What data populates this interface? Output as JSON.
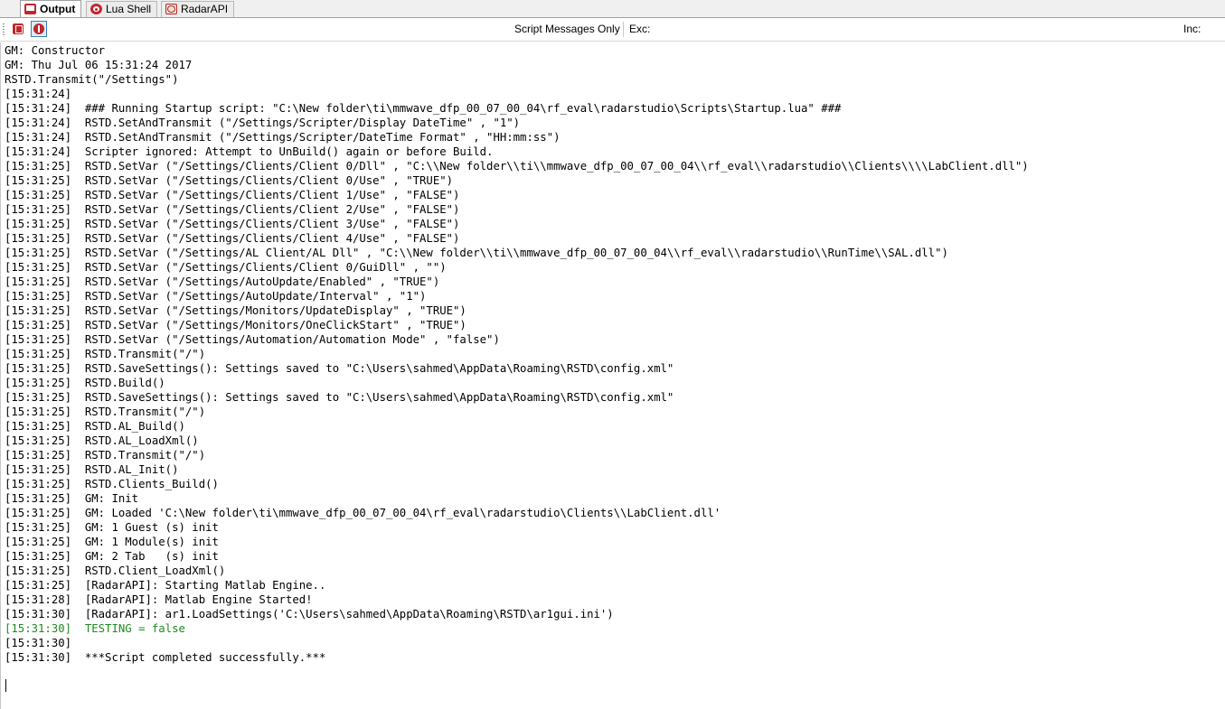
{
  "tabs": [
    {
      "label": "Output",
      "icon": "output-icon",
      "active": true
    },
    {
      "label": "Lua Shell",
      "icon": "lua-icon",
      "active": false
    },
    {
      "label": "RadarAPI",
      "icon": "radar-icon",
      "active": false
    }
  ],
  "toolbar": {
    "clear_icon": "clear-output-icon",
    "info_icon": "info-filter-icon",
    "filter_label": "Script Messages Only",
    "exc_label": "Exc:",
    "inc_label": "Inc:"
  },
  "colors": {
    "icon_red": "#c0282d",
    "success_green": "#1f8a1f"
  },
  "log_lines": [
    "GM: Constructor",
    "GM: Thu Jul 06 15:31:24 2017",
    "RSTD.Transmit(\"/Settings\")",
    "[15:31:24]",
    "[15:31:24]  ### Running Startup script: \"C:\\New folder\\ti\\mmwave_dfp_00_07_00_04\\rf_eval\\radarstudio\\Scripts\\Startup.lua\" ###",
    "[15:31:24]  RSTD.SetAndTransmit (\"/Settings/Scripter/Display DateTime\" , \"1\")",
    "[15:31:24]  RSTD.SetAndTransmit (\"/Settings/Scripter/DateTime Format\" , \"HH:mm:ss\")",
    "[15:31:24]  Scripter ignored: Attempt to UnBuild() again or before Build.",
    "[15:31:25]  RSTD.SetVar (\"/Settings/Clients/Client 0/Dll\" , \"C:\\\\New folder\\\\ti\\\\mmwave_dfp_00_07_00_04\\\\rf_eval\\\\radarstudio\\\\Clients\\\\\\\\LabClient.dll\")",
    "[15:31:25]  RSTD.SetVar (\"/Settings/Clients/Client 0/Use\" , \"TRUE\")",
    "[15:31:25]  RSTD.SetVar (\"/Settings/Clients/Client 1/Use\" , \"FALSE\")",
    "[15:31:25]  RSTD.SetVar (\"/Settings/Clients/Client 2/Use\" , \"FALSE\")",
    "[15:31:25]  RSTD.SetVar (\"/Settings/Clients/Client 3/Use\" , \"FALSE\")",
    "[15:31:25]  RSTD.SetVar (\"/Settings/Clients/Client 4/Use\" , \"FALSE\")",
    "[15:31:25]  RSTD.SetVar (\"/Settings/AL Client/AL Dll\" , \"C:\\\\New folder\\\\ti\\\\mmwave_dfp_00_07_00_04\\\\rf_eval\\\\radarstudio\\\\RunTime\\\\SAL.dll\")",
    "[15:31:25]  RSTD.SetVar (\"/Settings/Clients/Client 0/GuiDll\" , \"\")",
    "[15:31:25]  RSTD.SetVar (\"/Settings/AutoUpdate/Enabled\" , \"TRUE\")",
    "[15:31:25]  RSTD.SetVar (\"/Settings/AutoUpdate/Interval\" , \"1\")",
    "[15:31:25]  RSTD.SetVar (\"/Settings/Monitors/UpdateDisplay\" , \"TRUE\")",
    "[15:31:25]  RSTD.SetVar (\"/Settings/Monitors/OneClickStart\" , \"TRUE\")",
    "[15:31:25]  RSTD.SetVar (\"/Settings/Automation/Automation Mode\" , \"false\")",
    "[15:31:25]  RSTD.Transmit(\"/\")",
    "[15:31:25]  RSTD.SaveSettings(): Settings saved to \"C:\\Users\\sahmed\\AppData\\Roaming\\RSTD\\config.xml\"",
    "[15:31:25]  RSTD.Build()",
    "[15:31:25]  RSTD.SaveSettings(): Settings saved to \"C:\\Users\\sahmed\\AppData\\Roaming\\RSTD\\config.xml\"",
    "[15:31:25]  RSTD.Transmit(\"/\")",
    "[15:31:25]  RSTD.AL_Build()",
    "[15:31:25]  RSTD.AL_LoadXml()",
    "[15:31:25]  RSTD.Transmit(\"/\")",
    "[15:31:25]  RSTD.AL_Init()",
    "[15:31:25]  RSTD.Clients_Build()",
    "[15:31:25]  GM: Init",
    "[15:31:25]  GM: Loaded 'C:\\New folder\\ti\\mmwave_dfp_00_07_00_04\\rf_eval\\radarstudio\\Clients\\\\LabClient.dll'",
    "[15:31:25]  GM: 1 Guest (s) init",
    "[15:31:25]  GM: 1 Module(s) init",
    "[15:31:25]  GM: 2 Tab   (s) init",
    "[15:31:25]  RSTD.Client_LoadXml()",
    "[15:31:25]  [RadarAPI]: Starting Matlab Engine..",
    "[15:31:28]  [RadarAPI]: Matlab Engine Started!",
    "[15:31:30]  [RadarAPI]: ar1.LoadSettings('C:\\Users\\sahmed\\AppData\\Roaming\\RSTD\\ar1gui.ini')",
    "[15:31:30]  TESTING = false",
    "[15:31:30]",
    "[15:31:30]  ***Script completed successfully.***"
  ],
  "highlighted_line_indices": [
    40
  ]
}
